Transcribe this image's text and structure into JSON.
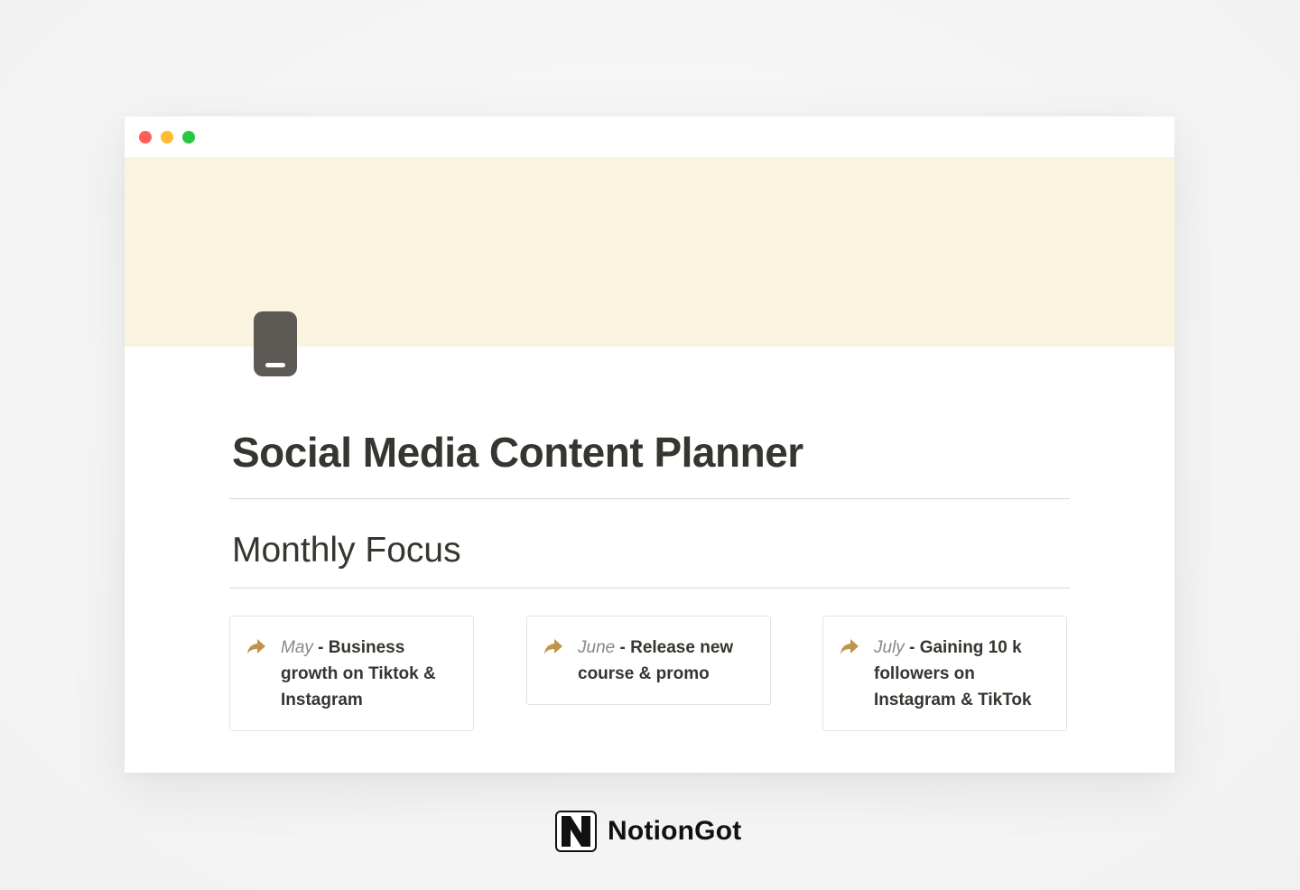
{
  "colors": {
    "cover": "#faf3df",
    "title_text": "#37352f",
    "accent_arrow": "#c0934a",
    "month_text": "#8a8883"
  },
  "window": {
    "controls": [
      "close",
      "minimize",
      "maximize"
    ]
  },
  "page": {
    "icon": "mobile-phone-icon",
    "title": "Social Media Content Planner",
    "section_heading": "Monthly Focus"
  },
  "callouts": [
    {
      "icon": "arrow-right-icon",
      "month": "May",
      "separator": " - ",
      "text": "Business growth on Tiktok & Instagram"
    },
    {
      "icon": "arrow-right-icon",
      "month": "June",
      "separator": " - ",
      "text": "Release new course & promo"
    },
    {
      "icon": "arrow-right-icon",
      "month": "July",
      "separator": " - ",
      "text": "Gaining 10 k followers on Instagram & TikTok"
    }
  ],
  "brand": {
    "logo": "notiongot-logo-icon",
    "logo_letter": "N",
    "name": "NotionGot"
  }
}
